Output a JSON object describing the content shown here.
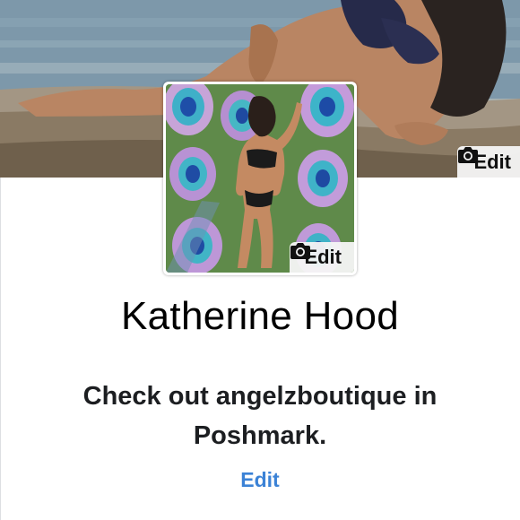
{
  "cover": {
    "edit_label": "Edit"
  },
  "profile_picture": {
    "edit_label": "Edit"
  },
  "profile": {
    "name": "Katherine Hood",
    "bio_line1": "Check out angelzboutique in",
    "bio_line2": "Poshmark.",
    "bio_edit_label": "Edit"
  },
  "colors": {
    "link_blue": "#3b82d6",
    "chip_bg": "#f5f5f5"
  },
  "icons": {
    "cover_edit": "camera-icon",
    "avatar_edit": "camera-icon"
  }
}
